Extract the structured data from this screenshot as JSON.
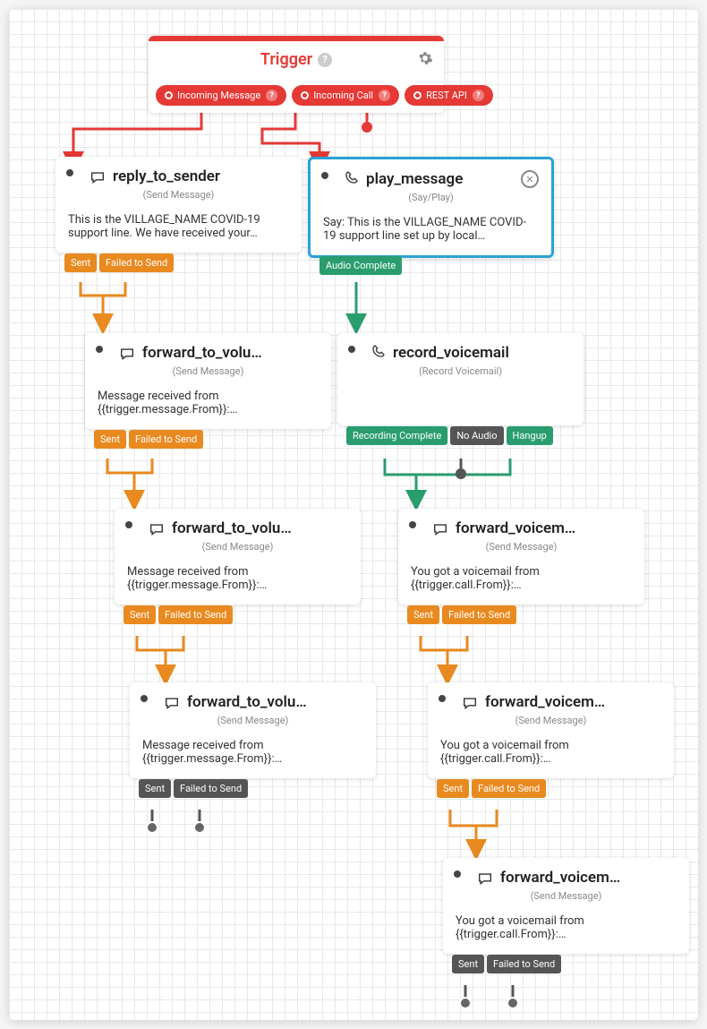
{
  "colors": {
    "trigger": "#e53935",
    "orange": "#e88a1f",
    "green": "#2a9d6f",
    "gray": "#555",
    "selected": "#29a3d6"
  },
  "trigger": {
    "title": "Trigger",
    "outputs": [
      {
        "label": "Incoming Message"
      },
      {
        "label": "Incoming Call"
      },
      {
        "label": "REST API"
      }
    ]
  },
  "widgets": {
    "reply_to_sender": {
      "title": "reply_to_sender",
      "subtitle": "(Send Message)",
      "icon": "message",
      "body": "This is the VILLAGE_NAME COVID-19 support line. We have received your…",
      "outputs": [
        {
          "label": "Sent",
          "color": "orange"
        },
        {
          "label": "Failed to Send",
          "color": "orange"
        }
      ]
    },
    "play_message": {
      "title": "play_message",
      "subtitle": "(Say/Play)",
      "icon": "phone",
      "selected": true,
      "body": "Say: This is the VILLAGE_NAME COVID-19 support line set up by local…",
      "outputs": [
        {
          "label": "Audio Complete",
          "color": "green"
        }
      ]
    },
    "forward_to_volu_1": {
      "title": "forward_to_volu…",
      "subtitle": "(Send Message)",
      "icon": "message",
      "body": "Message received from {{trigger.message.From}}:…",
      "outputs": [
        {
          "label": "Sent",
          "color": "orange"
        },
        {
          "label": "Failed to Send",
          "color": "orange"
        }
      ]
    },
    "record_voicemail": {
      "title": "record_voicemail",
      "subtitle": "(Record Voicemail)",
      "icon": "phone",
      "body": "",
      "outputs": [
        {
          "label": "Recording Complete",
          "color": "green"
        },
        {
          "label": "No Audio",
          "color": "gray"
        },
        {
          "label": "Hangup",
          "color": "green"
        }
      ]
    },
    "forward_to_volu_2": {
      "title": "forward_to_volu…",
      "subtitle": "(Send Message)",
      "icon": "message",
      "body": "Message received from {{trigger.message.From}}:…",
      "outputs": [
        {
          "label": "Sent",
          "color": "orange"
        },
        {
          "label": "Failed to Send",
          "color": "orange"
        }
      ]
    },
    "forward_voicem_1": {
      "title": "forward_voicem…",
      "subtitle": "(Send Message)",
      "icon": "message",
      "body": "You got a voicemail from {{trigger.call.From}}:…",
      "outputs": [
        {
          "label": "Sent",
          "color": "orange"
        },
        {
          "label": "Failed to Send",
          "color": "orange"
        }
      ]
    },
    "forward_to_volu_3": {
      "title": "forward_to_volu…",
      "subtitle": "(Send Message)",
      "icon": "message",
      "body": "Message received from {{trigger.message.From}}:…",
      "outputs": [
        {
          "label": "Sent",
          "color": "gray"
        },
        {
          "label": "Failed to Send",
          "color": "gray"
        }
      ]
    },
    "forward_voicem_2": {
      "title": "forward_voicem…",
      "subtitle": "(Send Message)",
      "icon": "message",
      "body": "You got a voicemail from {{trigger.call.From}}:…",
      "outputs": [
        {
          "label": "Sent",
          "color": "orange"
        },
        {
          "label": "Failed to Send",
          "color": "orange"
        }
      ]
    },
    "forward_voicem_3": {
      "title": "forward_voicem…",
      "subtitle": "(Send Message)",
      "icon": "message",
      "body": "You got a voicemail from {{trigger.call.From}}:…",
      "outputs": [
        {
          "label": "Sent",
          "color": "gray"
        },
        {
          "label": "Failed to Send",
          "color": "gray"
        }
      ]
    }
  }
}
